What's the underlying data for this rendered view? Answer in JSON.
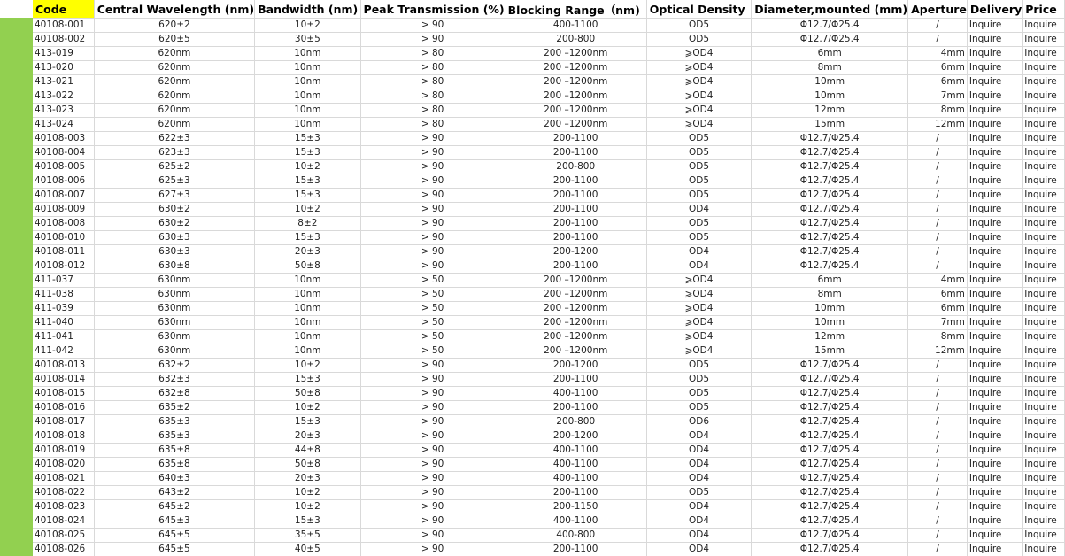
{
  "headers": {
    "code": "Code",
    "central_wavelength": "Central Wavelength (nm)",
    "bandwidth": "Bandwidth (nm)",
    "peak_transmission": "Peak Transmission (%)",
    "blocking_range": "Blocking Range（nm)",
    "optical_density": "Optical Density",
    "diameter": "Diameter,mounted (mm)",
    "aperture": "Aperture",
    "delivery": "Delivery",
    "price": "Price"
  },
  "rows": [
    [
      "40108-001",
      "620±2",
      "10±2",
      "> 90",
      "400-1100",
      "OD5",
      "Φ12.7/Φ25.4",
      "/",
      "Inquire",
      "Inquire"
    ],
    [
      "40108-002",
      "620±5",
      "30±5",
      "> 90",
      "200-800",
      "OD5",
      "Φ12.7/Φ25.4",
      "/",
      "Inquire",
      "Inquire"
    ],
    [
      "413-019",
      "620nm",
      "10nm",
      "> 80",
      "200 –1200nm",
      "⩾OD4",
      "6mm",
      "4mm",
      "Inquire",
      "Inquire"
    ],
    [
      "413-020",
      "620nm",
      "10nm",
      "> 80",
      "200 –1200nm",
      "⩾OD4",
      "8mm",
      "6mm",
      "Inquire",
      "Inquire"
    ],
    [
      "413-021",
      "620nm",
      "10nm",
      "> 80",
      "200 –1200nm",
      "⩾OD4",
      "10mm",
      "6mm",
      "Inquire",
      "Inquire"
    ],
    [
      "413-022",
      "620nm",
      "10nm",
      "> 80",
      "200 –1200nm",
      "⩾OD4",
      "10mm",
      "7mm",
      "Inquire",
      "Inquire"
    ],
    [
      "413-023",
      "620nm",
      "10nm",
      "> 80",
      "200 –1200nm",
      "⩾OD4",
      "12mm",
      "8mm",
      "Inquire",
      "Inquire"
    ],
    [
      "413-024",
      "620nm",
      "10nm",
      "> 80",
      "200 –1200nm",
      "⩾OD4",
      "15mm",
      "12mm",
      "Inquire",
      "Inquire"
    ],
    [
      "40108-003",
      "622±3",
      "15±3",
      "> 90",
      "200-1100",
      "OD5",
      "Φ12.7/Φ25.4",
      "/",
      "Inquire",
      "Inquire"
    ],
    [
      "40108-004",
      "623±3",
      "15±3",
      "> 90",
      "200-1100",
      "OD5",
      "Φ12.7/Φ25.4",
      "/",
      "Inquire",
      "Inquire"
    ],
    [
      "40108-005",
      "625±2",
      "10±2",
      "> 90",
      "200-800",
      "OD5",
      "Φ12.7/Φ25.4",
      "/",
      "Inquire",
      "Inquire"
    ],
    [
      "40108-006",
      "625±3",
      "15±3",
      "> 90",
      "200-1100",
      "OD5",
      "Φ12.7/Φ25.4",
      "/",
      "Inquire",
      "Inquire"
    ],
    [
      "40108-007",
      "627±3",
      "15±3",
      "> 90",
      "200-1100",
      "OD5",
      "Φ12.7/Φ25.4",
      "/",
      "Inquire",
      "Inquire"
    ],
    [
      "40108-009",
      "630±2",
      "10±2",
      "> 90",
      "200-1100",
      "OD4",
      "Φ12.7/Φ25.4",
      "/",
      "Inquire",
      "Inquire"
    ],
    [
      "40108-008",
      "630±2",
      "8±2",
      "> 90",
      "200-1100",
      "OD5",
      "Φ12.7/Φ25.4",
      "/",
      "Inquire",
      "Inquire"
    ],
    [
      "40108-010",
      "630±3",
      "15±3",
      "> 90",
      "200-1100",
      "OD5",
      "Φ12.7/Φ25.4",
      "/",
      "Inquire",
      "Inquire"
    ],
    [
      "40108-011",
      "630±3",
      "20±3",
      "> 90",
      "200-1200",
      "OD4",
      "Φ12.7/Φ25.4",
      "/",
      "Inquire",
      "Inquire"
    ],
    [
      "40108-012",
      "630±8",
      "50±8",
      "> 90",
      "200-1100",
      "OD4",
      "Φ12.7/Φ25.4",
      "/",
      "Inquire",
      "Inquire"
    ],
    [
      "411-037",
      "630nm",
      "10nm",
      "> 50",
      "200 –1200nm",
      "⩾OD4",
      "6mm",
      "4mm",
      "Inquire",
      "Inquire"
    ],
    [
      "411-038",
      "630nm",
      "10nm",
      "> 50",
      "200 –1200nm",
      "⩾OD4",
      "8mm",
      "6mm",
      "Inquire",
      "Inquire"
    ],
    [
      "411-039",
      "630nm",
      "10nm",
      "> 50",
      "200 –1200nm",
      "⩾OD4",
      "10mm",
      "6mm",
      "Inquire",
      "Inquire"
    ],
    [
      "411-040",
      "630nm",
      "10nm",
      "> 50",
      "200 –1200nm",
      "⩾OD4",
      "10mm",
      "7mm",
      "Inquire",
      "Inquire"
    ],
    [
      "411-041",
      "630nm",
      "10nm",
      "> 50",
      "200 –1200nm",
      "⩾OD4",
      "12mm",
      "8mm",
      "Inquire",
      "Inquire"
    ],
    [
      "411-042",
      "630nm",
      "10nm",
      "> 50",
      "200 –1200nm",
      "⩾OD4",
      "15mm",
      "12mm",
      "Inquire",
      "Inquire"
    ],
    [
      "40108-013",
      "632±2",
      "10±2",
      "> 90",
      "200-1200",
      "OD5",
      "Φ12.7/Φ25.4",
      "/",
      "Inquire",
      "Inquire"
    ],
    [
      "40108-014",
      "632±3",
      "15±3",
      "> 90",
      "200-1100",
      "OD5",
      "Φ12.7/Φ25.4",
      "/",
      "Inquire",
      "Inquire"
    ],
    [
      "40108-015",
      "632±8",
      "50±8",
      "> 90",
      "400-1100",
      "OD5",
      "Φ12.7/Φ25.4",
      "/",
      "Inquire",
      "Inquire"
    ],
    [
      "40108-016",
      "635±2",
      "10±2",
      "> 90",
      "200-1100",
      "OD5",
      "Φ12.7/Φ25.4",
      "/",
      "Inquire",
      "Inquire"
    ],
    [
      "40108-017",
      "635±3",
      "15±3",
      "> 90",
      "200-800",
      "OD6",
      "Φ12.7/Φ25.4",
      "/",
      "Inquire",
      "Inquire"
    ],
    [
      "40108-018",
      "635±3",
      "20±3",
      "> 90",
      "200-1200",
      "OD4",
      "Φ12.7/Φ25.4",
      "/",
      "Inquire",
      "Inquire"
    ],
    [
      "40108-019",
      "635±8",
      "44±8",
      "> 90",
      "400-1100",
      "OD4",
      "Φ12.7/Φ25.4",
      "/",
      "Inquire",
      "Inquire"
    ],
    [
      "40108-020",
      "635±8",
      "50±8",
      "> 90",
      "400-1100",
      "OD4",
      "Φ12.7/Φ25.4",
      "/",
      "Inquire",
      "Inquire"
    ],
    [
      "40108-021",
      "640±3",
      "20±3",
      "> 90",
      "400-1100",
      "OD4",
      "Φ12.7/Φ25.4",
      "/",
      "Inquire",
      "Inquire"
    ],
    [
      "40108-022",
      "643±2",
      "10±2",
      "> 90",
      "200-1100",
      "OD5",
      "Φ12.7/Φ25.4",
      "/",
      "Inquire",
      "Inquire"
    ],
    [
      "40108-023",
      "645±2",
      "10±2",
      "> 90",
      "200-1150",
      "OD4",
      "Φ12.7/Φ25.4",
      "/",
      "Inquire",
      "Inquire"
    ],
    [
      "40108-024",
      "645±3",
      "15±3",
      "> 90",
      "400-1100",
      "OD4",
      "Φ12.7/Φ25.4",
      "/",
      "Inquire",
      "Inquire"
    ],
    [
      "40108-025",
      "645±5",
      "35±5",
      "> 90",
      "400-800",
      "OD4",
      "Φ12.7/Φ25.4",
      "/",
      "Inquire",
      "Inquire"
    ],
    [
      "40108-026",
      "645±5",
      "40±5",
      "> 90",
      "200-1100",
      "OD4",
      "Φ12.7/Φ25.4",
      "/",
      "Inquire",
      "Inquire"
    ]
  ],
  "colors": {
    "left_bar": "#92d050",
    "code_header": "#ffff00",
    "grid": "#d9d9d9"
  }
}
